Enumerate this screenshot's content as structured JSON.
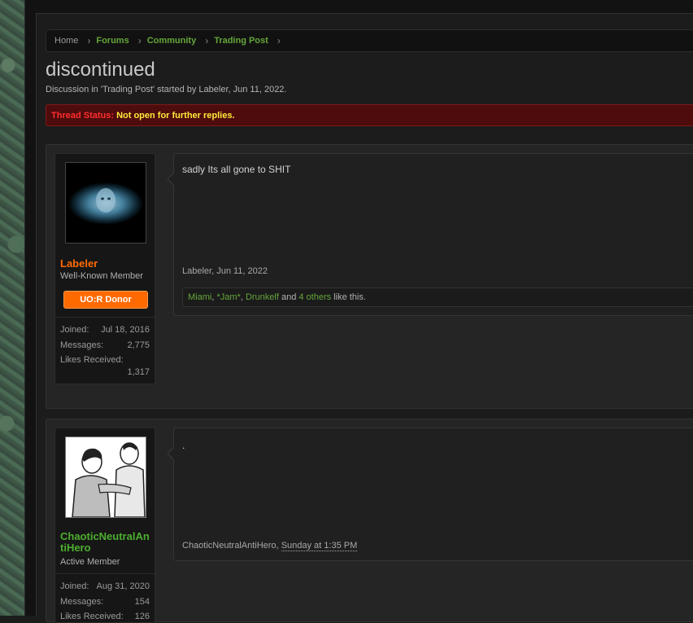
{
  "breadcrumb": {
    "items": [
      {
        "label": "Home"
      },
      {
        "label": "Forums"
      },
      {
        "label": "Community"
      },
      {
        "label": "Trading Post"
      }
    ],
    "separator": "›"
  },
  "thread": {
    "title": "discontinued",
    "description": "Discussion in 'Trading Post' started by Labeler, Jun 11, 2022.",
    "status_label": "Thread Status:",
    "status_value": "Not open for further replies."
  },
  "posts": [
    {
      "username": "Labeler",
      "user_title": "Well-Known Member",
      "badge": "UO:R Donor",
      "stats": {
        "joined_label": "Joined:",
        "joined": "Jul 18, 2016",
        "messages_label": "Messages:",
        "messages": "2,775",
        "likes_label": "Likes Received:",
        "likes": "1,317"
      },
      "message": "sadly Its all gone to SHIT",
      "meta_author": "Labeler,",
      "meta_date": "Jun 11, 2022",
      "likes": {
        "names": [
          "Miami",
          "*Jam*",
          "Drunkelf"
        ],
        "sep": ", ",
        "and": " and ",
        "others": "4 others",
        "suffix": " like this."
      }
    },
    {
      "username": "ChaoticNeutralAntiHero",
      "user_title": "Active Member",
      "stats": {
        "joined_label": "Joined:",
        "joined": "Aug 31, 2020",
        "messages_label": "Messages:",
        "messages": "154",
        "likes_label": "Likes Received:",
        "likes": "126"
      },
      "message": ".",
      "meta_author": "ChaoticNeutralAntiHero,",
      "meta_date": "Sunday at 1:35 PM"
    }
  ],
  "colors": {
    "link_green": "#64a63a",
    "username_orange": "#ff6a00",
    "status_red": "#ff2d2d",
    "status_yellow": "#ffeb3b",
    "donor_badge": "#ff6a00"
  }
}
